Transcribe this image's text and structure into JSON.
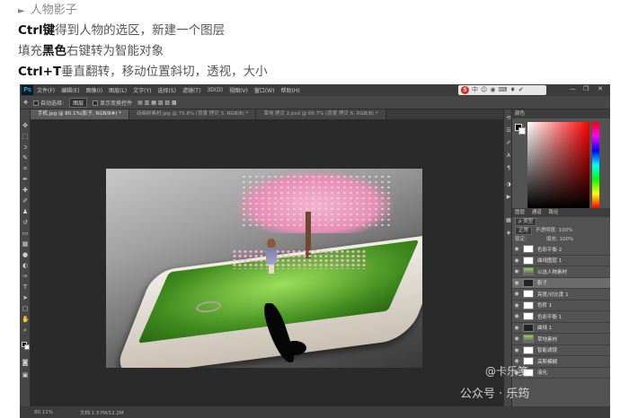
{
  "article": {
    "line1_arrow": "►",
    "line1_text": "人物影子",
    "line2_key": "Ctrl键",
    "line2_rest": "得到人物的选区，新建一个图层",
    "line3_pre": "填充",
    "line3_key": "黑色",
    "line3_rest": "右键转为智能对象",
    "line4_key": "Ctrl+T",
    "line4_rest": "垂直翻转，移动位置斜切，透视，大小"
  },
  "ps": {
    "logo": "Ps",
    "menus": [
      "文件(F)",
      "编辑(E)",
      "图像(I)",
      "图层(L)",
      "文字(Y)",
      "选择(S)",
      "滤镜(T)",
      "3D(D)",
      "视图(V)",
      "窗口(W)",
      "帮助(H)"
    ],
    "tray": [
      "S",
      "中",
      "☺",
      "◉",
      "⌨",
      "♦",
      "✔"
    ],
    "win_controls": [
      "—",
      "❐",
      "✕"
    ],
    "options": {
      "auto_select": "自动选择:",
      "layer_box": "图层",
      "show_transform": "显示变换控件"
    },
    "tabs": [
      "手机.jpg @ 80.1%(影子, RGB/8#) *",
      "动画树素材.jpg @ 75.8% (背景 拷贝 3, RGB/8) *",
      "草地 拷贝 2.psd @ 66.7% (背景 拷贝 6, RGB/8) *"
    ],
    "status": {
      "zoom": "80.11%",
      "doc": "文档:1.57M/12.2M"
    },
    "panel": {
      "color_tabs": [
        "颜色"
      ],
      "layer_tabs": [
        "图层",
        "通道",
        "路径"
      ],
      "filter": "ρ 类型",
      "mode": "正常",
      "opacity": "不透明度: 100%",
      "lock": "锁定:",
      "fill": "填充: 100%",
      "layers": [
        {
          "name": "色彩平衡 2",
          "thumb": "white"
        },
        {
          "name": "曲线图层 1",
          "thumb": "white"
        },
        {
          "name": "以选人物素材",
          "thumb": "photo"
        },
        {
          "name": "影子",
          "thumb": "dark",
          "selected": true
        },
        {
          "name": "亮度/对比度 1",
          "thumb": "white"
        },
        {
          "name": "色阶 1",
          "thumb": "white"
        },
        {
          "name": "色彩平衡 1",
          "thumb": "white"
        },
        {
          "name": "曲线 1",
          "thumb": "dark"
        },
        {
          "name": "草地素材",
          "thumb": "photo"
        },
        {
          "name": "智能滤镜",
          "thumb": "white"
        },
        {
          "name": "高斯模糊",
          "thumb": "white"
        },
        {
          "name": "液化",
          "thumb": "white"
        }
      ]
    }
  },
  "watermark": {
    "line1": "@卡乐笺",
    "line2": "公众号 · 乐筠"
  }
}
